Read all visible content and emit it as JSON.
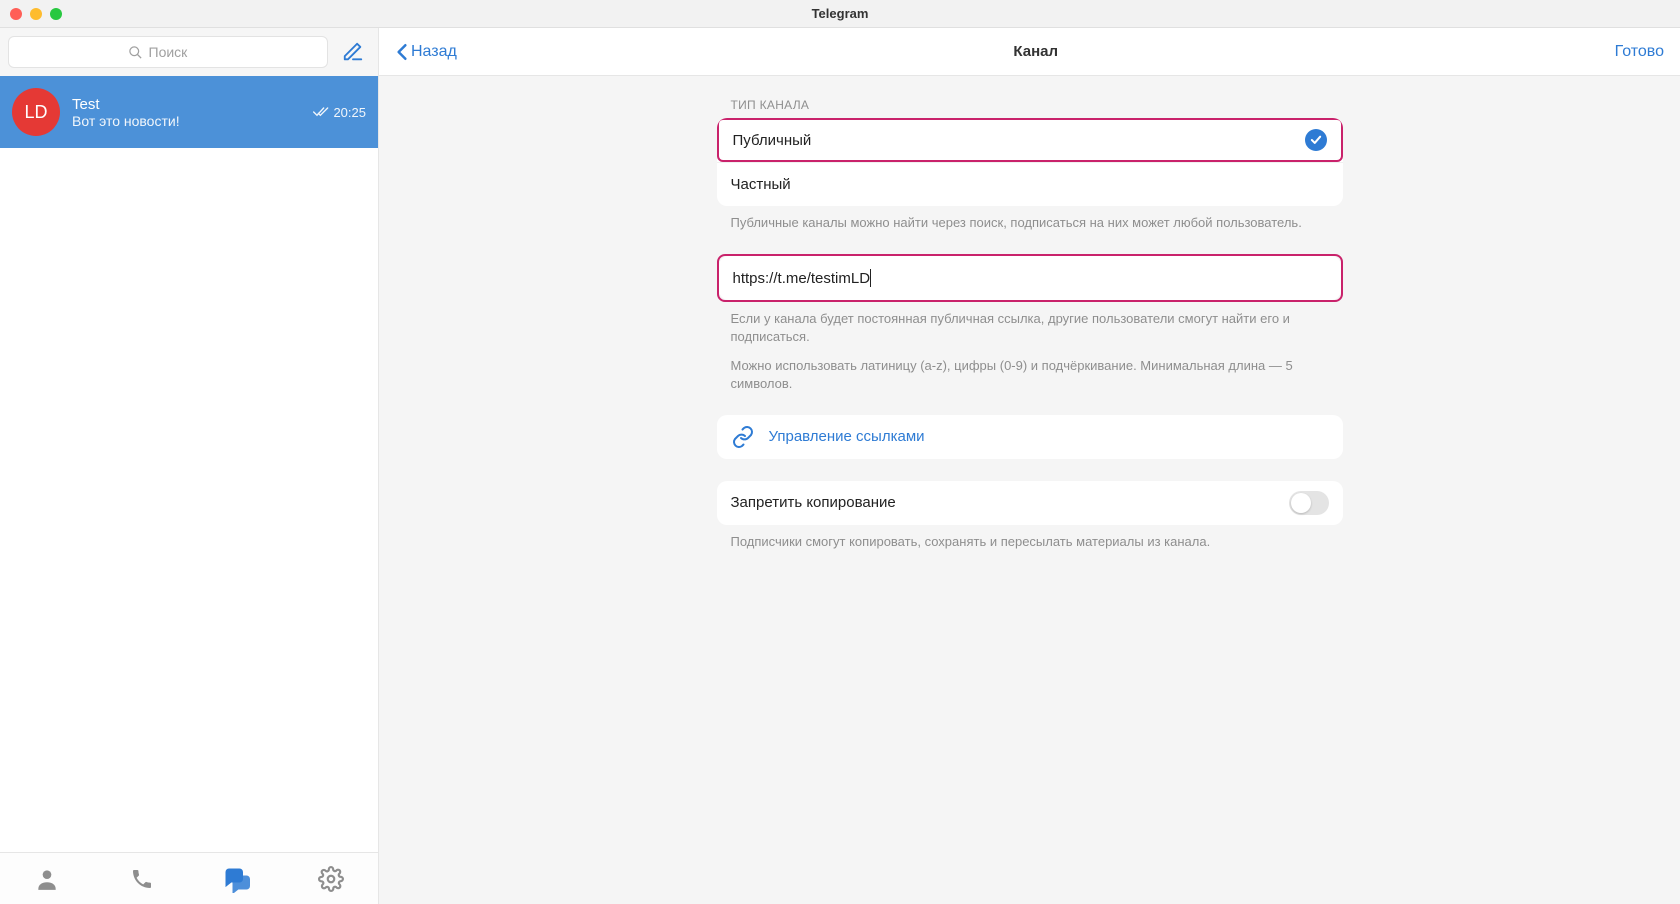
{
  "titlebar": {
    "title": "Telegram"
  },
  "sidebar": {
    "search_placeholder": "Поиск",
    "chats": [
      {
        "avatar_initials": "LD",
        "name": "Test",
        "preview": "Вот это новости!",
        "time": "20:25"
      }
    ]
  },
  "main": {
    "back_label": "Назад",
    "title": "Канал",
    "done_label": "Готово",
    "channel_type_section_label": "ТИП КАНАЛА",
    "type_public": "Публичный",
    "type_private": "Частный",
    "type_hint": "Публичные каналы можно найти через поиск, подписаться на них может любой пользователь.",
    "link_prefix": "https://t.me/",
    "link_value": "testimLD",
    "link_hint1": "Если у канала будет постоянная публичная ссылка, другие пользователи смогут найти его и подписаться.",
    "link_hint2": "Можно использовать латиницу (a-z), цифры (0-9) и подчёркивание. Минимальная длина — 5 символов.",
    "manage_links_label": "Управление ссылками",
    "restrict_copy_label": "Запретить копирование",
    "restrict_copy_hint": "Подписчики смогут копировать, сохранять и пересылать материалы из канала."
  }
}
